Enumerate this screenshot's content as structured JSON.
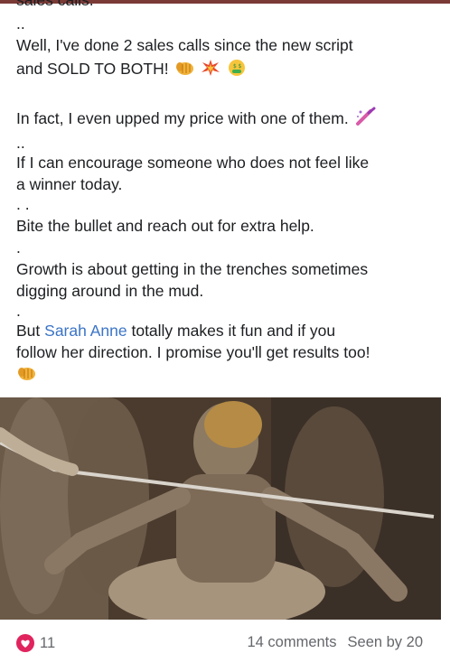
{
  "post": {
    "cut_top_line": "sales calls.",
    "lines": {
      "l1": "..",
      "l2": "Well, I've done 2 sales calls since the new script",
      "l3a": "and SOLD TO BOTH!",
      "l4": "In fact, I even upped my price with one of them.",
      "l5": "..",
      "l6": "If I can encourage someone who does not feel like",
      "l7": "a winner today.",
      "l8": ". .",
      "l9": "Bite the bullet and reach out for extra help.",
      "l10": ".",
      "l11": "Growth is about getting in the trenches sometimes",
      "l12": "digging around in the mud.",
      "l13": ".",
      "l14_pre": "But ",
      "l14_mention": "Sarah Anne",
      "l14_post": " totally makes it fun and if you",
      "l15": "follow her direction. I promise you'll get results too!"
    },
    "emojis": [
      "fist-bump-icon",
      "collision-icon",
      "money-mouth-face-icon",
      "nail-polish-icon",
      "fist-bump-icon"
    ]
  },
  "colors": {
    "mention": "#3b74c7",
    "heart": "#e0245e",
    "meta_text": "#65676b",
    "top_bar": "#7a3a36"
  },
  "footer": {
    "reaction_count": "11",
    "comments": "14 comments",
    "seen_by": "Seen by 20"
  }
}
